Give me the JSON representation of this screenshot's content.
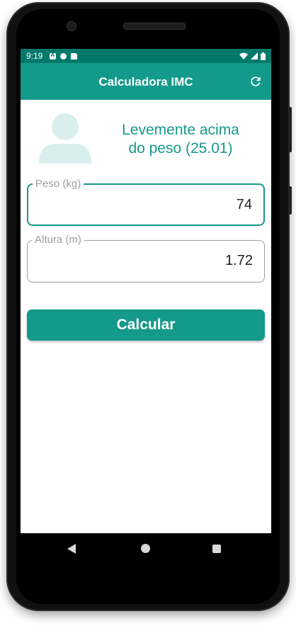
{
  "status_bar": {
    "time": "9:19",
    "icons_left": [
      "a-notification-icon",
      "p-notification-icon",
      "sd-card-icon"
    ],
    "icons_right": [
      "wifi-icon",
      "signal-icon",
      "battery-icon"
    ]
  },
  "app_bar": {
    "title": "Calculadora IMC",
    "action_icon": "refresh-icon"
  },
  "result": {
    "avatar_icon": "person-avatar-icon",
    "line1": "Levemente acima",
    "line2": "do peso (25.01)"
  },
  "fields": {
    "weight": {
      "label": "Peso (kg)",
      "value": "74"
    },
    "height": {
      "label": "Altura (m)",
      "value": "1.72"
    }
  },
  "button": {
    "label": "Calcular"
  },
  "navigation": {
    "icons": [
      "back-icon",
      "home-icon",
      "recents-icon"
    ]
  },
  "colors": {
    "status_bar": "#00796b",
    "app_bar": "#149a8a",
    "accent_text": "#17998a",
    "avatar": "#d9efed"
  }
}
